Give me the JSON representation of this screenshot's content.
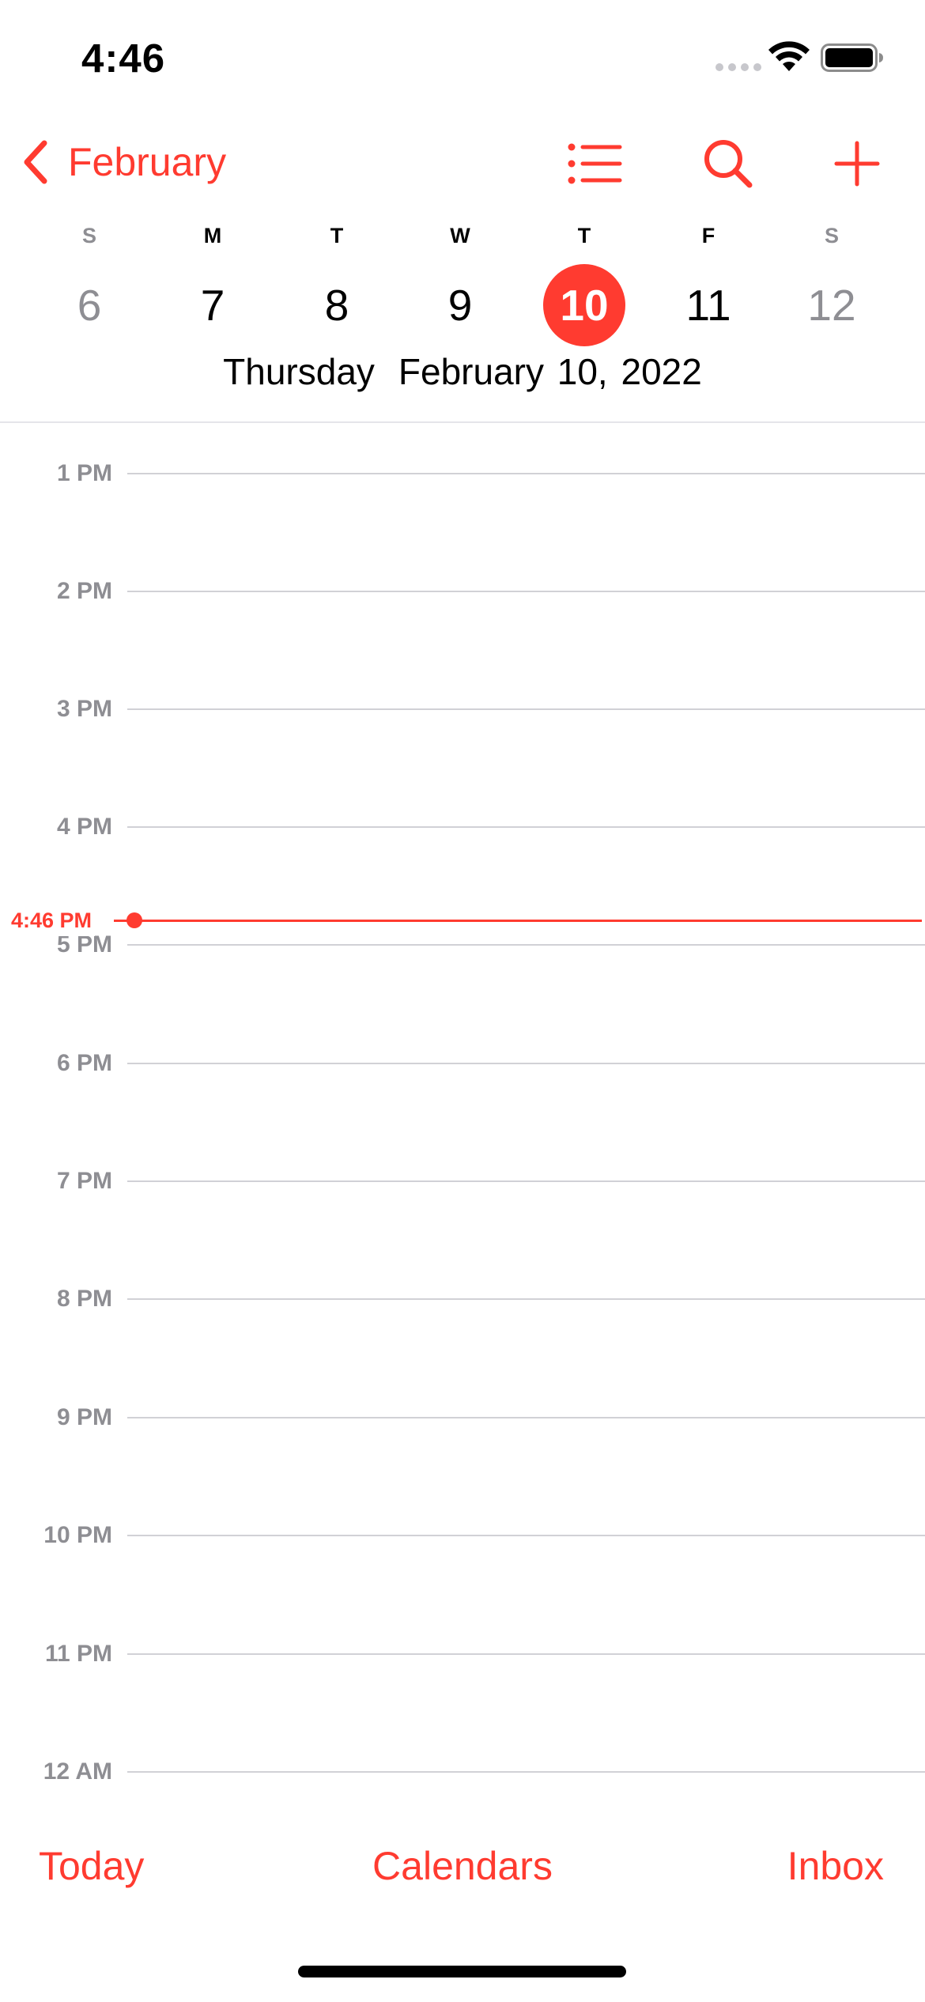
{
  "status_bar": {
    "time": "4:46"
  },
  "nav": {
    "back_label": "February"
  },
  "week": {
    "weekdays": [
      "S",
      "M",
      "T",
      "W",
      "T",
      "F",
      "S"
    ],
    "dates": [
      "6",
      "7",
      "8",
      "9",
      "10",
      "11",
      "12"
    ],
    "selected_index": 4,
    "selected_weekday": "Thursday",
    "selected_full_date": "February 10, 2022"
  },
  "timeline": {
    "hours": [
      "1 PM",
      "2 PM",
      "3 PM",
      "4 PM",
      "5 PM",
      "6 PM",
      "7 PM",
      "8 PM",
      "9 PM",
      "10 PM",
      "11 PM",
      "12 AM"
    ],
    "current_time_label": "4:46 PM"
  },
  "toolbar": {
    "today_label": "Today",
    "calendars_label": "Calendars",
    "inbox_label": "Inbox"
  },
  "colors": {
    "accent": "#ff3b30",
    "secondary_text": "#8e8e93",
    "grid_line": "#d1d1d6"
  },
  "icons": {
    "back": "chevron-left-icon",
    "list": "list-icon",
    "search": "search-icon",
    "add": "plus-icon",
    "wifi": "wifi-icon",
    "battery": "battery-icon",
    "cellular": "cellular-signal-icon"
  }
}
